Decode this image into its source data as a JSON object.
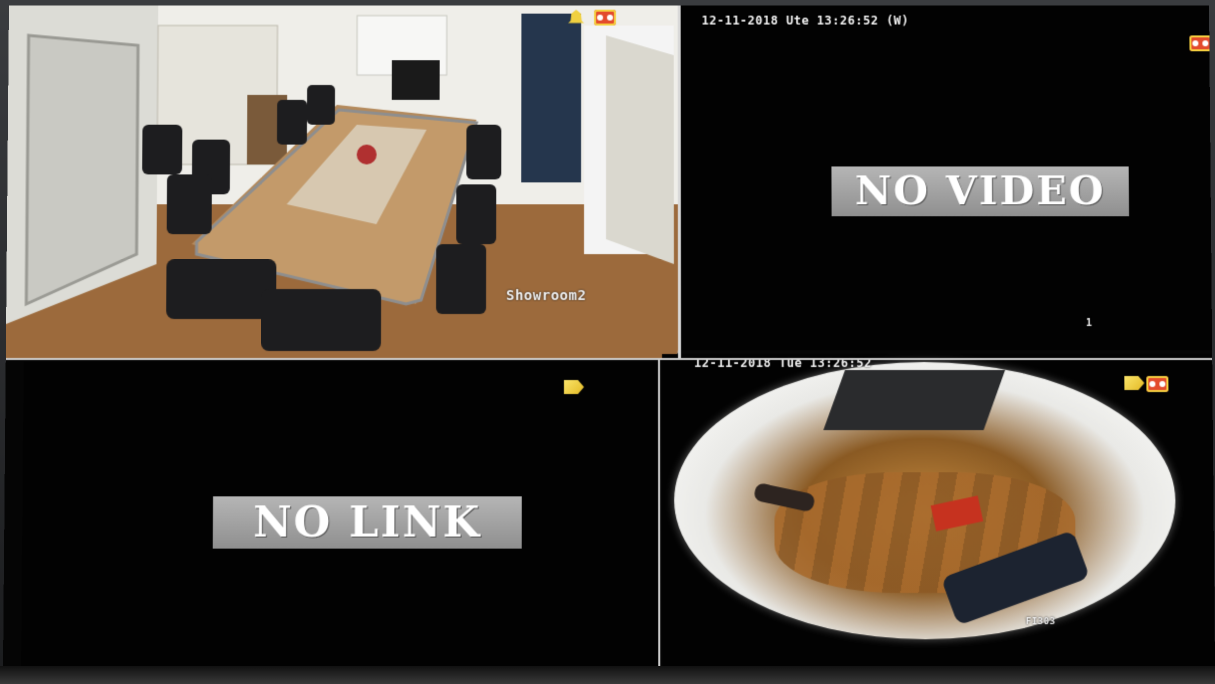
{
  "cameras": [
    {
      "id": "ch1",
      "name": "Showroom2",
      "timestamp": "",
      "feed": "conference-room-scene",
      "status_icons": [
        "bell-icon",
        "record-icon"
      ]
    },
    {
      "id": "ch2",
      "timestamp": "12-11-2018 Ute 13:26:52 (W)",
      "message": "NO VIDEO",
      "channel_number": "1",
      "status_icons": [
        "record-icon"
      ]
    },
    {
      "id": "ch3",
      "message": "NO LINK",
      "status_icons": [
        "motion-icon"
      ]
    },
    {
      "id": "ch4",
      "timestamp": "12-11-2018 Tue 13:26:52",
      "name": "FI303",
      "feed": "fisheye-office-scene",
      "status_icons": [
        "motion-icon",
        "record-icon"
      ]
    }
  ],
  "colors": {
    "osd_text": "#f2f2f2",
    "banner_bg": "#a5a5a5",
    "record_icon": "#e34b2c",
    "motion_icon": "#f0d040"
  }
}
